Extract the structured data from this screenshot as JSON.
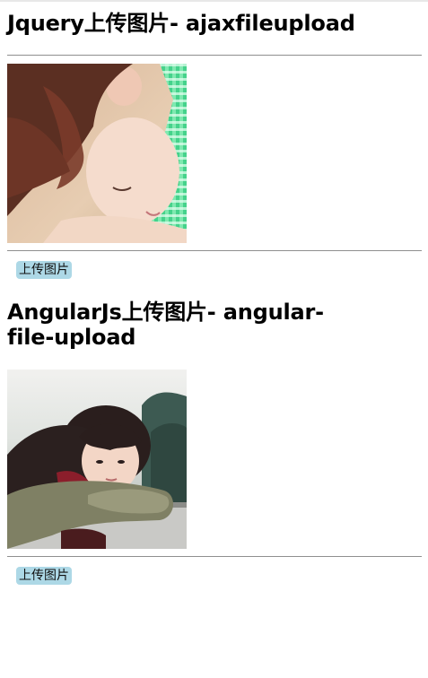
{
  "sections": [
    {
      "title": "Jquery上传图片- ajaxfileupload",
      "upload_button_label": "上传图片"
    },
    {
      "title": "AngularJs上传图片- angular-file-upload",
      "upload_button_label": "上传图片"
    }
  ],
  "colors": {
    "button_bg": "#add8e6",
    "rule": "#8f8f8f"
  }
}
